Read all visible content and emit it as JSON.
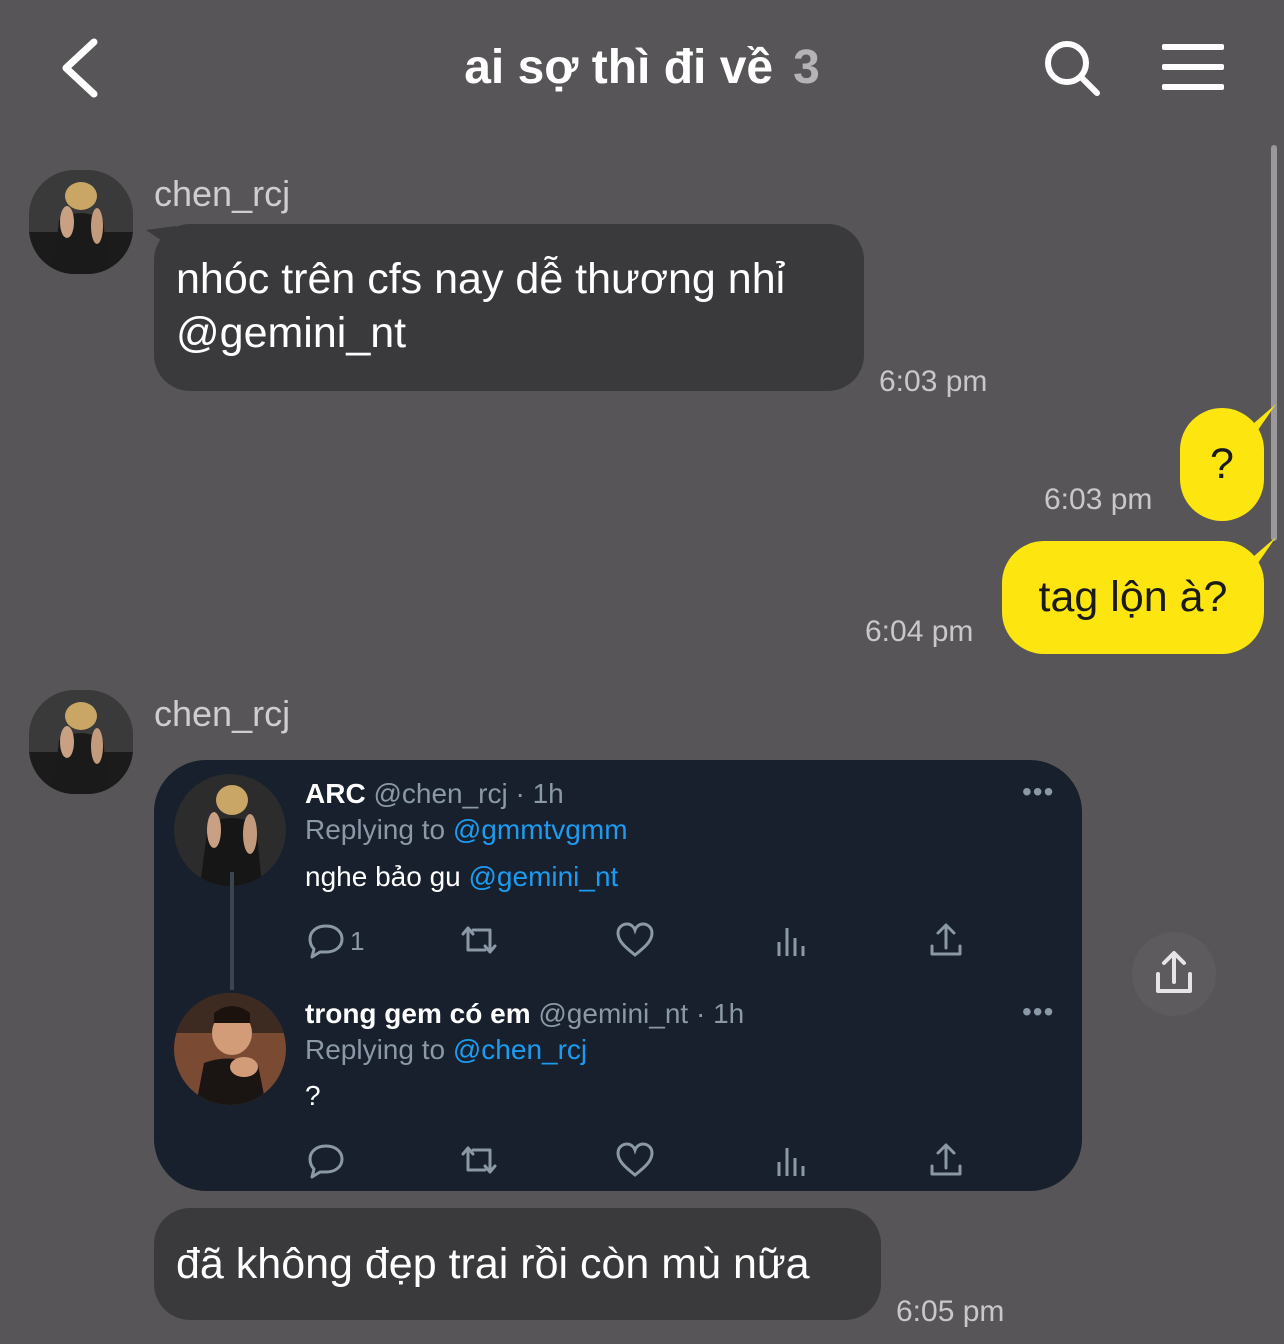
{
  "header": {
    "title": "ai sợ thì đi về",
    "member_count": "3",
    "back_icon": "chevron-left-icon",
    "search_icon": "search-icon",
    "menu_icon": "hamburger-menu-icon"
  },
  "colors": {
    "background": "#575557",
    "incoming_bubble": "#3a393b",
    "outgoing_bubble": "#fde60f",
    "tweet_card": "#17202c",
    "link": "#1d9bf0"
  },
  "messages": [
    {
      "sender": "chen_rcj",
      "text_line1": "nhóc trên cfs nay dễ thương nhỉ",
      "text_line2": "@gemini_nt",
      "time": "6:03 pm"
    },
    {
      "sender": "me",
      "text": "?",
      "time": "6:03 pm"
    },
    {
      "sender": "me",
      "text": "tag lộn à?",
      "time": "6:04 pm"
    },
    {
      "sender": "chen_rcj",
      "type": "tweet_share"
    },
    {
      "sender": "chen_rcj",
      "text": "đã không đẹp trai rồi còn mù nữa",
      "time": "6:05 pm"
    }
  ],
  "tweet": {
    "first": {
      "name": "ARC",
      "handle": "@chen_rcj",
      "age": "· 1h",
      "replying_label": "Replying to",
      "replying_to": "@gmmtvgmm",
      "text": "nghe bảo gu",
      "mention": "@gemini_nt",
      "reply_count": "1"
    },
    "second": {
      "name": "trong gem có em",
      "handle": "@gemini_nt",
      "age": "· 1h",
      "replying_label": "Replying to",
      "replying_to": "@chen_rcj",
      "text": "?"
    },
    "more_icon": "•••"
  },
  "share_icon": "share-icon"
}
